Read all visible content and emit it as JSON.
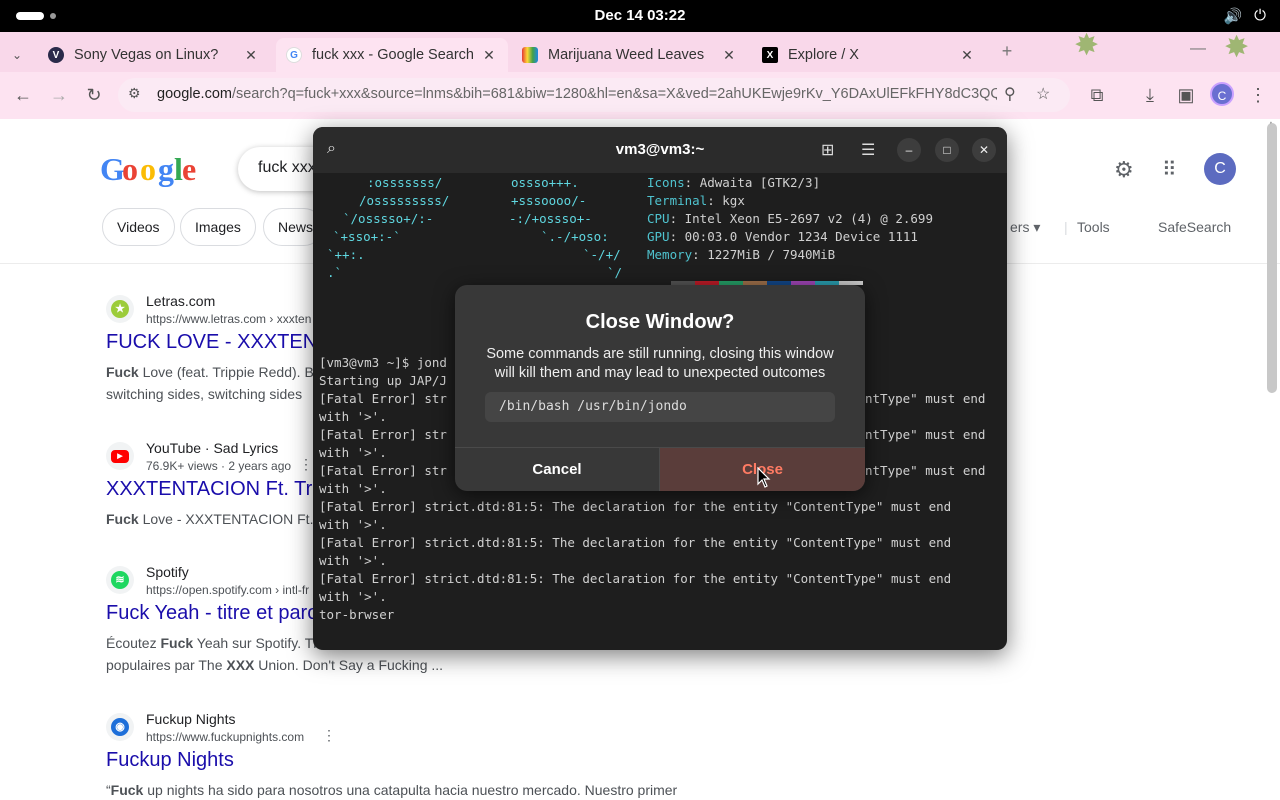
{
  "topbar": {
    "clock": "Dec 14  03:22"
  },
  "browser": {
    "tabs": [
      {
        "title": "Sony Vegas on Linux?",
        "favicon": "V"
      },
      {
        "title": "fuck xxx - Google Search",
        "favicon": "G"
      },
      {
        "title": "Marijuana Weed Leaves",
        "favicon": "rainbow"
      },
      {
        "title": "Explore / X",
        "favicon": "X"
      }
    ],
    "url_host": "google.com",
    "url_rest": "/search?q=fuck+xxx&source=lnms&bih=681&biw=1280&hl=en&sa=X&ved=2ahUKEwje9rKv_Y6DAxUlEFkFHY8dC3QQ0p...",
    "profile_initial": "C"
  },
  "google": {
    "query": "fuck xxx",
    "avatar": "C",
    "chips": [
      "Videos",
      "Images",
      "News"
    ],
    "filters_partial": "ers",
    "tools": "Tools",
    "safesearch": "SafeSearch",
    "results": [
      {
        "site": "Letras.com",
        "cite": "https://www.letras.com › xxxten",
        "title": "FUCK LOVE - XXXTENTA",
        "snippet_bold": "Fuck",
        "snippet": " Love (feat. Trippie Redd). Ba",
        "snippet2": "switching sides, switching sides"
      },
      {
        "site": "YouTube · Sad Lyrics",
        "cite": "76.9K+ views · 2 years ago",
        "title": "XXXTENTACION Ft. Trip",
        "snippet_bold": "Fuck",
        "snippet": " Love - XXXTENTACION Ft. T",
        "snippet2": ""
      },
      {
        "site": "Spotify",
        "cite": "https://open.spotify.com › intl-fr",
        "title": "Fuck Yeah - titre et paro",
        "snippet_pre": "Écoutez ",
        "snippet_bold": "Fuck",
        "snippet": " Yeah sur Spotify. Th",
        "snippet2_pre": "populaires par The ",
        "snippet2_bold": "XXX",
        "snippet2": " Union. Don't Say a Fucking ..."
      },
      {
        "site": "Fuckup Nights",
        "cite": "https://www.fuckupnights.com",
        "title": "Fuckup Nights",
        "snippet_pre": "“",
        "snippet_bold": "Fuck",
        "snippet": " up nights ha sido para nosotros una catapulta hacia nuestro mercado. Nuestro primer",
        "snippet2": ""
      }
    ]
  },
  "terminal": {
    "title": "vm3@vm3:~",
    "art_left": [
      ":osssssss/",
      "/osssssssss/",
      "`/osssso+/:-",
      "`+sso+:-`",
      "`++:.",
      ".`"
    ],
    "art_right": [
      "ossso+++.",
      "+sssoooo/-",
      "-:/+ossso+-",
      "`.-/+oso:",
      "`-/+/",
      "`/"
    ],
    "info": [
      {
        "key": "Icons",
        "value": ": Adwaita [GTK2/3]"
      },
      {
        "key": "Terminal",
        "value": ": kgx"
      },
      {
        "key": "CPU",
        "value": ": Intel Xeon E5-2697 v2 (4) @ 2.699"
      },
      {
        "key": "GPU",
        "value": ": 00:03.0 Vendor 1234 Device 1111"
      },
      {
        "key": "Memory",
        "value": ": 1227MiB / 7940MiB"
      }
    ],
    "palette": [
      "#555555",
      "#c01c28",
      "#26a269",
      "#a2734c",
      "#12488b",
      "#a347ba",
      "#2aa1b3",
      "#cfcfcf"
    ],
    "lines": [
      "[vm3@vm3 ~]$ jond",
      "Starting up JAP/J",
      "[Fatal Error] str",
      "with '>'.",
      "[Fatal Error] str",
      "with '>'.",
      "[Fatal Error] str",
      "with '>'.",
      "[Fatal Error] strict.dtd:81:5: The declaration for the entity \"ContentType\" must end",
      "with '>'.",
      "[Fatal Error] strict.dtd:81:5: The declaration for the entity \"ContentType\" must end",
      "with '>'.",
      "[Fatal Error] strict.dtd:81:5: The declaration for the entity \"ContentType\" must end",
      "with '>'.",
      "tor-brwser"
    ],
    "right_fragments": [
      "ntType\" must end",
      "ntType\" must end",
      "ntType\" must end"
    ]
  },
  "dialog": {
    "title": "Close Window?",
    "message": "Some commands are still running, closing this window will kill them and may lead to unexpected outcomes",
    "command": "/bin/bash /usr/bin/jondo",
    "cancel": "Cancel",
    "close": "Close"
  }
}
